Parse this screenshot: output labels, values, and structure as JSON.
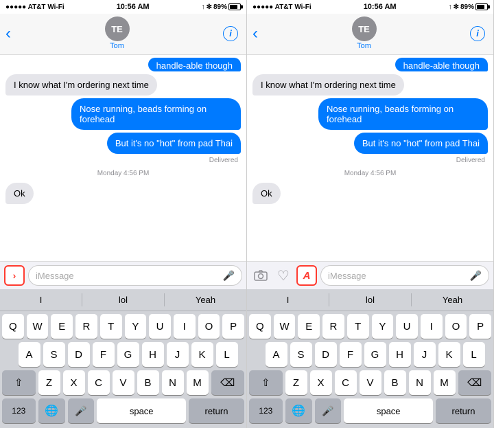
{
  "panels": [
    {
      "id": "left",
      "statusBar": {
        "left": "AT&T Wi-Fi",
        "center": "10:56 AM",
        "right": "89%"
      },
      "nav": {
        "backLabel": "‹",
        "contactInitials": "TE",
        "contactName": "Tom",
        "infoLabel": "i"
      },
      "messages": [
        {
          "type": "incoming",
          "text": "handle-able though",
          "partial": true
        },
        {
          "type": "incoming",
          "text": "I know what I'm ordering next time"
        },
        {
          "type": "outgoing",
          "text": "Nose running, beads forming on forehead"
        },
        {
          "type": "outgoing",
          "text": "But it's no \"hot\" from pad Thai",
          "delivered": true
        }
      ],
      "timestamp": "Monday 4:56 PM",
      "ok": "Ok",
      "inputPlaceholder": "iMessage",
      "expandBtn": "›",
      "expandHighlight": false,
      "showExtraIcons": false,
      "suggestions": [
        "I",
        "lol",
        "Yeah"
      ],
      "keyRows": [
        [
          "Q",
          "W",
          "E",
          "R",
          "T",
          "Y",
          "U",
          "I",
          "O",
          "P"
        ],
        [
          "A",
          "S",
          "D",
          "F",
          "G",
          "H",
          "J",
          "K",
          "L"
        ],
        [
          "⇧",
          "Z",
          "X",
          "C",
          "V",
          "B",
          "N",
          "M",
          "⌫"
        ],
        [
          "123",
          "🌐",
          "🎤",
          "space",
          "return"
        ]
      ]
    },
    {
      "id": "right",
      "statusBar": {
        "left": "AT&T Wi-Fi",
        "center": "10:56 AM",
        "right": "89%"
      },
      "nav": {
        "backLabel": "‹",
        "contactInitials": "TE",
        "contactName": "Tom",
        "infoLabel": "i"
      },
      "messages": [
        {
          "type": "incoming",
          "text": "handle-able though",
          "partial": true
        },
        {
          "type": "incoming",
          "text": "I know what I'm ordering next time"
        },
        {
          "type": "outgoing",
          "text": "Nose running, beads forming on forehead"
        },
        {
          "type": "outgoing",
          "text": "But it's no \"hot\" from pad Thai",
          "delivered": true
        }
      ],
      "timestamp": "Monday 4:56 PM",
      "ok": "Ok",
      "inputPlaceholder": "iMessage",
      "expandBtn": "A",
      "expandHighlight": true,
      "showExtraIcons": true,
      "suggestions": [
        "I",
        "lol",
        "Yeah"
      ],
      "keyRows": [
        [
          "Q",
          "W",
          "E",
          "R",
          "T",
          "Y",
          "U",
          "I",
          "O",
          "P"
        ],
        [
          "A",
          "S",
          "D",
          "F",
          "G",
          "H",
          "J",
          "K",
          "L"
        ],
        [
          "⇧",
          "Z",
          "X",
          "C",
          "V",
          "B",
          "N",
          "M",
          "⌫"
        ],
        [
          "123",
          "🌐",
          "🎤",
          "space",
          "return"
        ]
      ]
    }
  ]
}
